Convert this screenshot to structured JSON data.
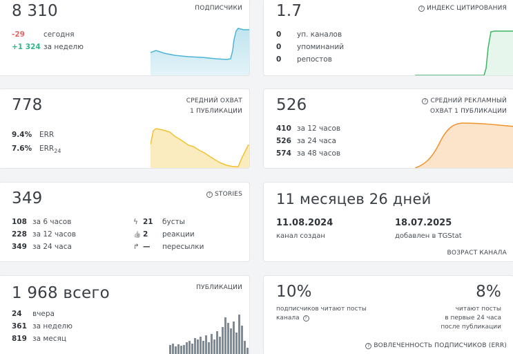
{
  "subscribers": {
    "value": "8 310",
    "title": "ПОДПИСЧИКИ",
    "today_value": "-29",
    "today_label": "сегодня",
    "week_value": "+1 324",
    "week_label": "за неделю"
  },
  "citation": {
    "value": "1.7",
    "title": "ИНДЕКС ЦИТИРОВАНИЯ",
    "rows": [
      {
        "value": "0",
        "label": "уп. каналов"
      },
      {
        "value": "0",
        "label": "упоминаний"
      },
      {
        "value": "0",
        "label": "репостов"
      }
    ]
  },
  "reach": {
    "value": "778",
    "title_line1": "СРЕДНИЙ ОХВАТ",
    "title_line2": "1 ПУБЛИКАЦИИ",
    "err_value": "9.4%",
    "err_label": "ERR",
    "err24_value": "7.6%",
    "err24_label": "ERR",
    "err24_sub": "24"
  },
  "ad_reach": {
    "value": "526",
    "title_line1": "СРЕДНИЙ РЕКЛАМНЫЙ",
    "title_line2": "ОХВАТ 1 ПУБЛИКАЦИИ",
    "rows": [
      {
        "value": "410",
        "label": "за 12 часов"
      },
      {
        "value": "526",
        "label": "за 24 часа"
      },
      {
        "value": "574",
        "label": "за 48 часов"
      }
    ]
  },
  "stories": {
    "value": "349",
    "title": "STORIES",
    "rows": [
      {
        "value": "108",
        "label": "за 6 часов"
      },
      {
        "value": "228",
        "label": "за 12 часов"
      },
      {
        "value": "349",
        "label": "за 24 часа"
      }
    ],
    "stats": [
      {
        "icon": "lightning-icon",
        "glyph": "ϟ",
        "value": "21",
        "label": "бусты"
      },
      {
        "icon": "thumbs-up-icon",
        "glyph": "👍",
        "value": "2",
        "label": "реакции"
      },
      {
        "icon": "share-arrow-icon",
        "glyph": "↱",
        "value": "—",
        "label": "пересылки"
      }
    ]
  },
  "age": {
    "value": "11 месяцев 26 дней",
    "created_date": "11.08.2024",
    "created_label": "канал создан",
    "added_date": "18.07.2025",
    "added_label": "добавлен в TGStat",
    "title": "ВОЗРАСТ КАНАЛА"
  },
  "publications": {
    "value": "1 968",
    "value_suffix": "всего",
    "title": "ПУБЛИКАЦИИ",
    "rows": [
      {
        "value": "24",
        "label": "вчера"
      },
      {
        "value": "361",
        "label": "за неделю"
      },
      {
        "value": "819",
        "label": "за месяц"
      }
    ]
  },
  "engagement": {
    "left_value": "10%",
    "left_label_line1": "подписчиков читают посты",
    "left_label_line2": "канала",
    "right_value": "8%",
    "right_label_line1": "читают посты",
    "right_label_line2": "в первые 24 часа",
    "right_label_line3": "после публикации",
    "title": "ВОВЛЕЧЕННОСТЬ ПОДПИСЧИКОВ (ERR)"
  },
  "colors": {
    "subscribers": "#4bb3d4",
    "citation": "#3cb660",
    "reach": "#f2c12e",
    "ad_reach": "#f0932b",
    "publications": "#7d8a99"
  }
}
